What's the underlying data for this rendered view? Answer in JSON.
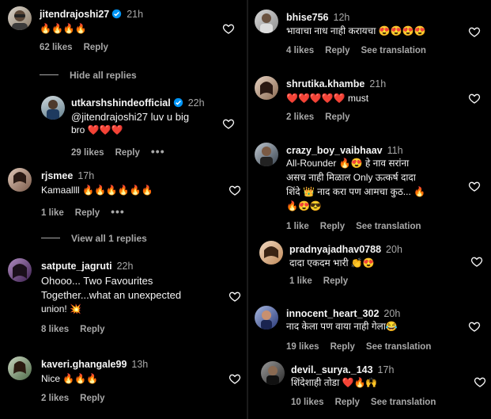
{
  "left": {
    "c1": {
      "user": "jitendrajoshi27",
      "time": "21h",
      "text": "🔥🔥🔥🔥",
      "likes": "62 likes",
      "reply": "Reply"
    },
    "hide_replies": "Hide all replies",
    "r1": {
      "user": "utkarshshindeofficial",
      "time": "22h",
      "text1": "@jitendrajoshi27 luv u big",
      "text2": "bro ❤️❤️❤️",
      "likes": "29 likes",
      "reply": "Reply",
      "more": "•••"
    },
    "c2": {
      "user": "rjsmee",
      "time": "17h",
      "text": "Kamaallll 🔥🔥🔥🔥🔥🔥",
      "likes": "1 like",
      "reply": "Reply",
      "more": "•••"
    },
    "view_replies": "View all 1 replies",
    "c3": {
      "user": "satpute_jagruti",
      "time": "22h",
      "text1": "Ohooo... Two Favourites",
      "text2": "Together...what an unexpected",
      "text3": "union! 💥",
      "likes": "8 likes",
      "reply": "Reply"
    },
    "c4": {
      "user": "kaveri.ghangale99",
      "time": "13h",
      "text": "Nice 🔥🔥🔥",
      "likes": "2 likes",
      "reply": "Reply"
    }
  },
  "right": {
    "c1": {
      "user": "bhise756",
      "time": "12h",
      "text": "भावाचा नाध नाही करायचा 😍😍😍😍",
      "likes": "4 likes",
      "reply": "Reply",
      "see": "See translation"
    },
    "c2": {
      "user": "shrutika.khambe",
      "time": "21h",
      "text": "❤️❤️❤️❤️❤️ must",
      "likes": "2 likes",
      "reply": "Reply"
    },
    "c3": {
      "user": "crazy_boy_vaibhaav",
      "time": "11h",
      "text1": "All-Rounder 🔥😍 हे नाव सरांना",
      "text2": "असच नाही मिळाल Only ऊत्कर्ष दादा",
      "text3": "शिंदे 👑 नाद करा पण आमचा कुठ... 🔥",
      "text4": "🔥😍😎",
      "likes": "1 like",
      "reply": "Reply",
      "see": "See translation"
    },
    "c4": {
      "user": "pradnyajadhav0788",
      "time": "20h",
      "text": "दादा एकदम भारी 👏😍",
      "likes": "1 like",
      "reply": "Reply"
    },
    "c5": {
      "user": "innocent_heart_302",
      "time": "20h",
      "text": "नाद केला पण वाया नाही गेला😂",
      "likes": "19 likes",
      "reply": "Reply",
      "see": "See translation"
    },
    "c6": {
      "user": "devil._surya._143",
      "time": "17h",
      "text": "शिंदेशाही तोडा ❤️🔥🙌",
      "likes": "10 likes",
      "reply": "Reply",
      "see": "See translation"
    }
  },
  "colors": {
    "bg": "#000000",
    "text": "#f5f5f5",
    "muted": "#a8a8a8",
    "verified": "#0095f6"
  }
}
